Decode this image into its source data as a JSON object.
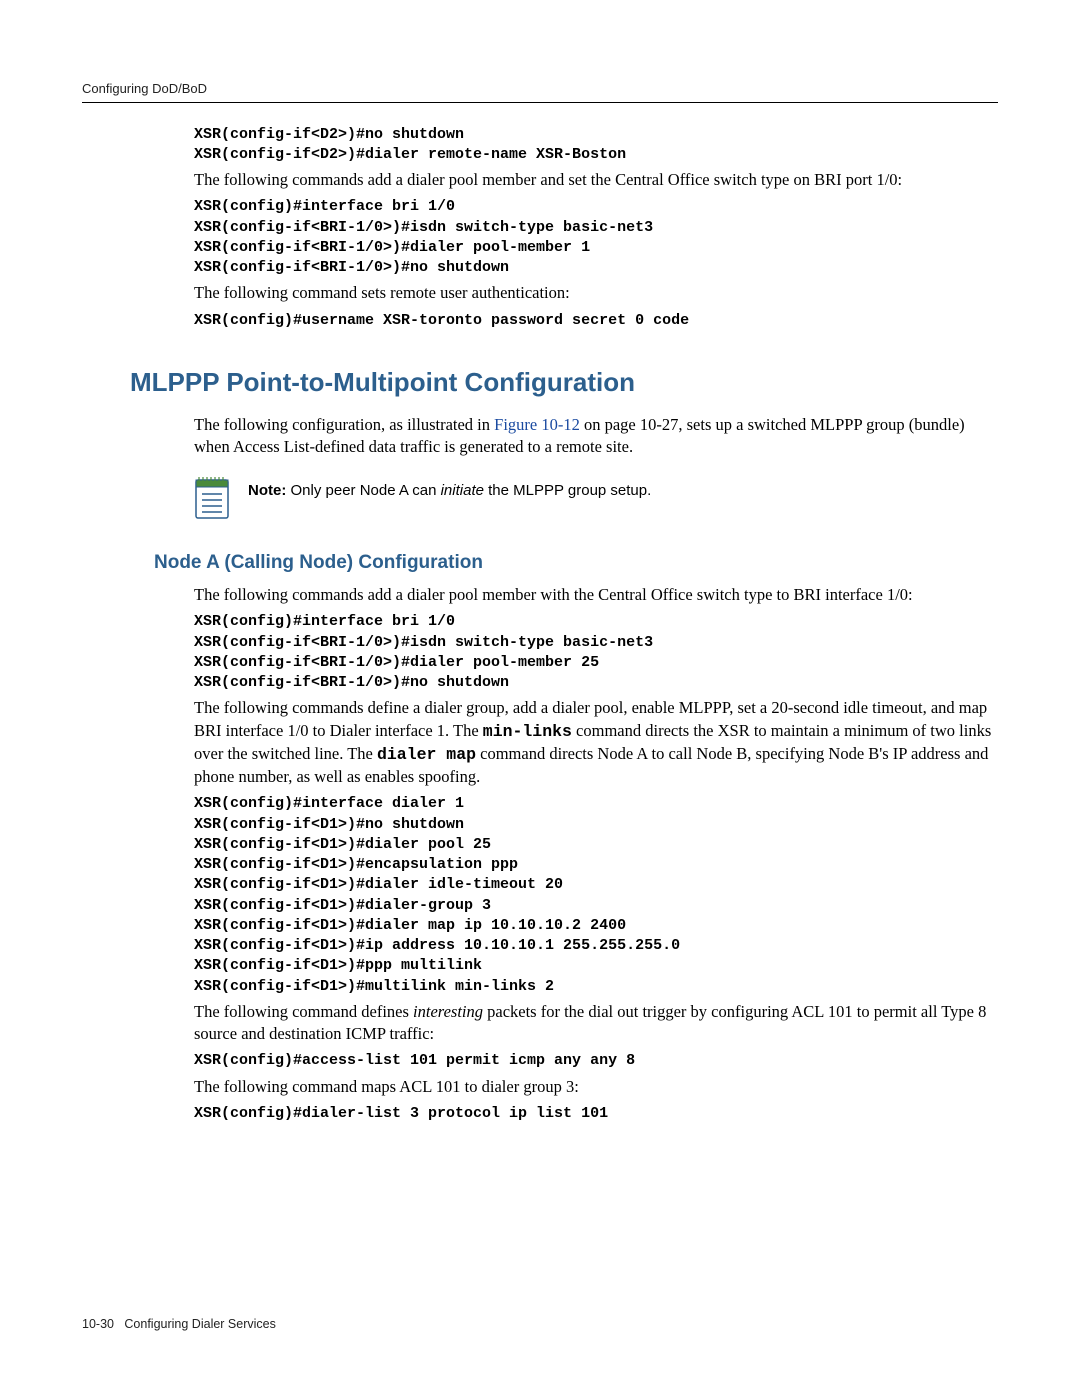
{
  "running_head": "Configuring DoD/BoD",
  "block1": {
    "cmds": [
      "XSR(config-if<D2>)#no shutdown",
      "XSR(config-if<D2>)#dialer remote-name XSR-Boston"
    ],
    "para": "The following commands add a dialer pool member and set the Central Office switch type on BRI port 1/0:",
    "cmds2": [
      "XSR(config)#interface bri 1/0",
      "XSR(config-if<BRI-1/0>)#isdn switch-type basic-net3",
      "XSR(config-if<BRI-1/0>)#dialer pool-member 1",
      "XSR(config-if<BRI-1/0>)#no shutdown"
    ],
    "para2": "The following command sets remote user authentication:",
    "cmds3": [
      "XSR(config)#username XSR-toronto password secret 0 code"
    ]
  },
  "h1": "MLPPP Point-to-Multipoint Configuration",
  "section_intro_a": "The following configuration, as illustrated in ",
  "section_intro_link": "Figure 10-12",
  "section_intro_b": " on page 10-27, sets up a switched MLPPP group (bundle) when Access List-defined data traffic is generated to a remote site.",
  "note": {
    "label": "Note:",
    "before": " Only peer Node A can ",
    "ital": "initiate",
    "after": " the MLPPP group setup."
  },
  "h2": "Node A (Calling Node) Configuration",
  "nodeA": {
    "para1": "The following commands add a dialer pool member with the Central Office switch type to BRI interface 1/0:",
    "cmds1": [
      "XSR(config)#interface bri 1/0",
      "XSR(config-if<BRI-1/0>)#isdn switch-type basic-net3",
      "XSR(config-if<BRI-1/0>)#dialer pool-member 25",
      "XSR(config-if<BRI-1/0>)#no shutdown"
    ],
    "para2_a": "The following commands define a dialer group, add a dialer pool, enable MLPPP, set a 20-second idle timeout, and map BRI interface 1/0 to Dialer interface 1. The ",
    "para2_code1": "min-links",
    "para2_b": " command directs the XSR to maintain a minimum of two links over the switched line. The ",
    "para2_code2": "dialer map",
    "para2_c": " command directs Node A to call Node B, specifying Node B's IP address and phone number, as well as enables spoofing.",
    "cmds2": [
      "XSR(config)#interface dialer 1",
      "XSR(config-if<D1>)#no shutdown",
      "XSR(config-if<D1>)#dialer pool 25",
      "XSR(config-if<D1>)#encapsulation ppp",
      "XSR(config-if<D1>)#dialer idle-timeout 20",
      "XSR(config-if<D1>)#dialer-group 3",
      "XSR(config-if<D1>)#dialer map ip 10.10.10.2 2400",
      "XSR(config-if<D1>)#ip address 10.10.10.1 255.255.255.0",
      "XSR(config-if<D1>)#ppp multilink",
      "XSR(config-if<D1>)#multilink min-links 2"
    ],
    "para3_a": "The following command defines ",
    "para3_ital": "interesting",
    "para3_b": " packets for the dial out trigger by configuring ACL 101 to permit all Type 8 source and destination ICMP traffic:",
    "cmds3": [
      "XSR(config)#access-list 101 permit icmp any any 8"
    ],
    "para4": "The following command maps ACL 101 to dialer group 3:",
    "cmds4": [
      "XSR(config)#dialer-list 3 protocol ip list 101"
    ]
  },
  "footer": {
    "page": "10-30",
    "title": "Configuring Dialer Services"
  }
}
